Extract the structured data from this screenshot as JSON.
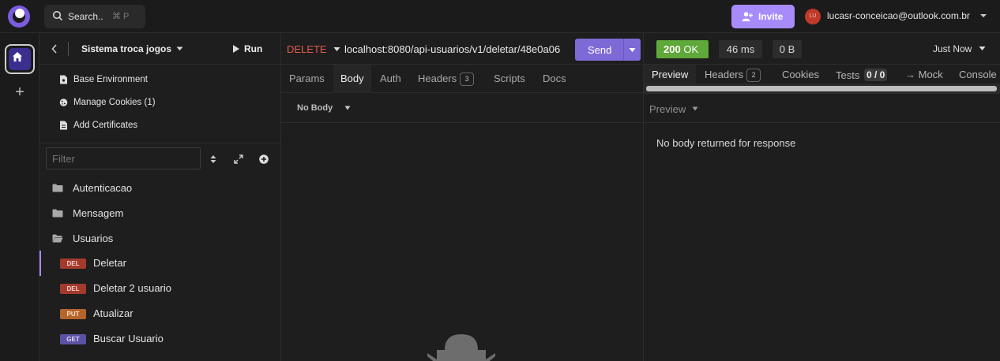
{
  "topbar": {
    "search_label": "Search..",
    "search_shortcut": "⌘ P",
    "invite_label": "Invite",
    "avatar_initials": "LU",
    "account_email": "lucasr-conceicao@outlook.com.br"
  },
  "sidebar": {
    "project_title": "Sistema troca jogos",
    "run_label": "Run",
    "links": [
      "Base Environment",
      "Manage Cookies (1)",
      "Add Certificates"
    ],
    "filter_placeholder": "Filter",
    "folders": [
      "Autenticacao",
      "Mensagem",
      "Usuarios"
    ],
    "requests": [
      {
        "method": "DEL",
        "name": "Deletar"
      },
      {
        "method": "DEL",
        "name": "Deletar 2 usuario"
      },
      {
        "method": "PUT",
        "name": "Atualizar"
      },
      {
        "method": "GET",
        "name": "Buscar Usuario"
      }
    ]
  },
  "request": {
    "verb": "DELETE",
    "url": "localhost:8080/api-usuarios/v1/deletar/48e0a06",
    "send_label": "Send",
    "tabs": [
      "Params",
      "Body",
      "Auth",
      "Headers",
      "Scripts",
      "Docs"
    ],
    "active_tab": "Body",
    "headers_count": "3",
    "body_type": "No Body"
  },
  "response": {
    "status_code": "200",
    "status_text": "OK",
    "time": "46 ms",
    "size": "0 B",
    "timestamp": "Just Now",
    "tabs": [
      "Preview",
      "Headers",
      "Cookies",
      "Tests",
      "→ Mock",
      "Console"
    ],
    "headers_count": "2",
    "tests_count": "0 / 0",
    "preview_label": "Preview",
    "empty_message": "No body returned for response"
  },
  "colors": {
    "accent": "#a78bfa",
    "send": "#7e6ad6",
    "status_ok": "#5fa83a",
    "delete_verb": "#e05a4b",
    "method_del": "#a33a2c",
    "method_put": "#b5652a",
    "method_get": "#5b52a3"
  }
}
